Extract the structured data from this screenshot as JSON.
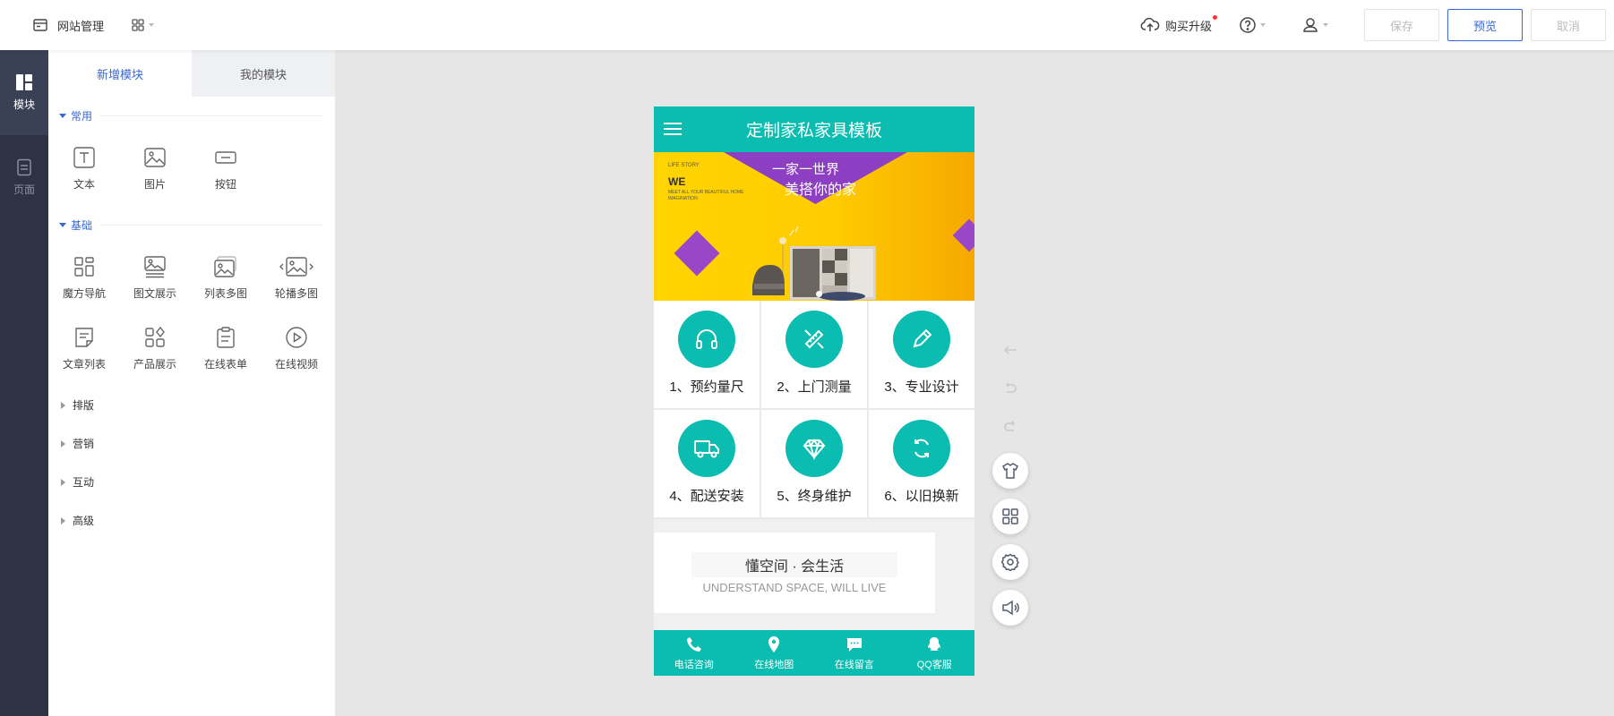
{
  "topbar": {
    "title": "网站管理",
    "upgrade_label": "购买升级",
    "save_label": "保存",
    "preview_label": "预览",
    "cancel_label": "取消"
  },
  "rail": {
    "items": [
      {
        "label": "模块",
        "icon": "module-icon",
        "active": true
      },
      {
        "label": "页面",
        "icon": "page-icon",
        "active": false
      }
    ]
  },
  "panel": {
    "tabs": [
      {
        "label": "新增模块",
        "active": true
      },
      {
        "label": "我的模块",
        "active": false
      }
    ],
    "sections": {
      "common": {
        "title": "常用",
        "items": [
          {
            "label": "文本",
            "icon": "text-icon"
          },
          {
            "label": "图片",
            "icon": "image-icon"
          },
          {
            "label": "按钮",
            "icon": "button-icon"
          }
        ]
      },
      "basic": {
        "title": "基础",
        "items": [
          {
            "label": "魔方导航",
            "icon": "grid-nav-icon"
          },
          {
            "label": "图文展示",
            "icon": "image-text-icon"
          },
          {
            "label": "列表多图",
            "icon": "list-images-icon"
          },
          {
            "label": "轮播多图",
            "icon": "carousel-icon"
          },
          {
            "label": "文章列表",
            "icon": "article-list-icon"
          },
          {
            "label": "产品展示",
            "icon": "product-icon"
          },
          {
            "label": "在线表单",
            "icon": "form-icon"
          },
          {
            "label": "在线视频",
            "icon": "video-icon"
          }
        ]
      }
    },
    "collapsed": [
      "排版",
      "营销",
      "互动",
      "高级"
    ]
  },
  "phone": {
    "title": "定制家私家具模板",
    "banner": {
      "line1": "LIFE STORY",
      "we": "WE",
      "line2": "MEET ALL YOUR BEAUTIFUL HOME IMAGINATION",
      "headline1": "一家一世界",
      "headline2": "美搭你的家"
    },
    "services": [
      {
        "label": "1、预约量尺",
        "icon": "headset-icon"
      },
      {
        "label": "2、上门测量",
        "icon": "ruler-pencil-icon"
      },
      {
        "label": "3、专业设计",
        "icon": "pencil-icon"
      },
      {
        "label": "4、配送安装",
        "icon": "truck-icon"
      },
      {
        "label": "5、终身维护",
        "icon": "diamond-icon"
      },
      {
        "label": "6、以旧换新",
        "icon": "refresh-icon"
      }
    ],
    "slogan": {
      "cn": "懂空间 · 会生活",
      "en": "UNDERSTAND SPACE, WILL LIVE"
    },
    "footer": [
      {
        "label": "电话咨询",
        "icon": "phone-icon"
      },
      {
        "label": "在线地图",
        "icon": "map-pin-icon"
      },
      {
        "label": "在线留言",
        "icon": "message-icon"
      },
      {
        "label": "QQ客服",
        "icon": "qq-icon"
      }
    ]
  },
  "side_tools": [
    "back-arrow-icon",
    "undo-icon",
    "redo-icon",
    "shirt-icon",
    "apps-icon",
    "settings-icon",
    "speaker-icon"
  ],
  "colors": {
    "accent": "#3867d6",
    "teal": "#0bbcb0",
    "rail": "#2d3244",
    "banner_purple": "#8c3fc2",
    "banner_yellow": "#ffd400"
  }
}
